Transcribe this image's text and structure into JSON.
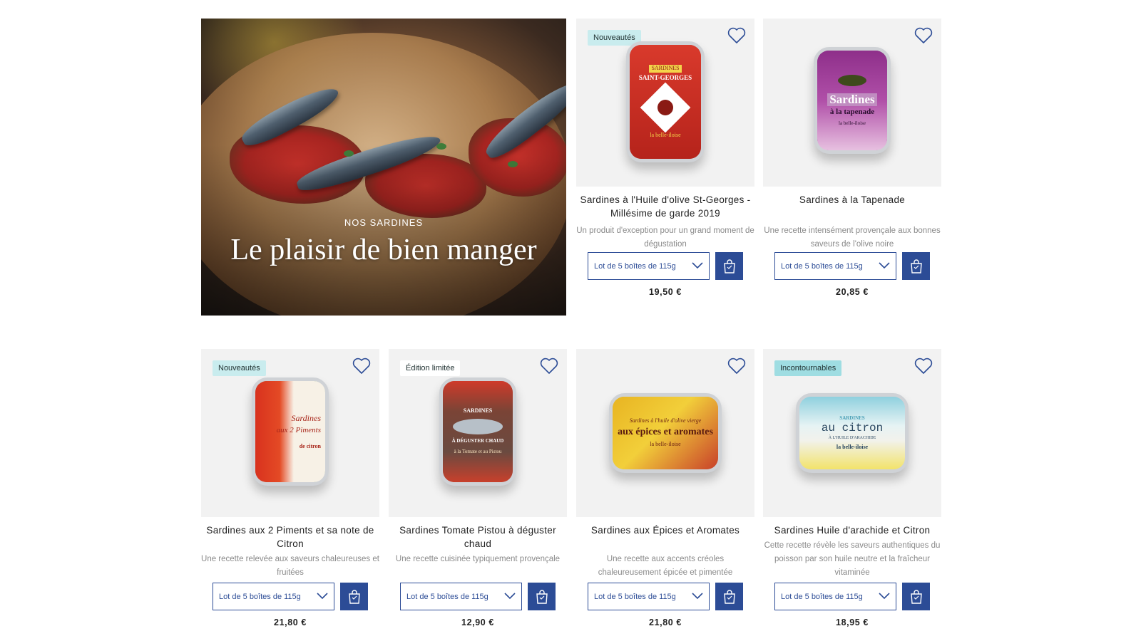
{
  "hero": {
    "kicker": "NOS SARDINES",
    "headline": "Le plaisir de bien manger"
  },
  "colors": {
    "accent": "#2c4c96",
    "badge_new": "#c9ecee",
    "badge_essential": "#9fdde2",
    "badge_limited": "#ffffff"
  },
  "products": [
    {
      "badge": "Nouveautés",
      "title": "Sardines à l'Huile d'olive St-Georges - Millésime de garde 2019",
      "description": "Un produit d'exception pour un grand moment de dégustation",
      "lot": "Lot de 5 boîtes de 115g",
      "price": "19,50 €",
      "can_text": [
        "SARDINES",
        "SAINT-GEORGES",
        "la belle-iloise"
      ]
    },
    {
      "badge": "",
      "title": "Sardines à la Tapenade",
      "description": "Une recette intensément provençale aux bonnes saveurs de l'olive noire",
      "lot": "Lot de 5 boîtes de 115g",
      "price": "20,85 €",
      "can_text": [
        "Sardines",
        "à la tapenade",
        "la belle-iloise"
      ]
    },
    {
      "badge": "Nouveautés",
      "title": "Sardines aux 2 Piments et sa note de Citron",
      "description": "Une recette relevée aux saveurs chaleureuses et fruitées",
      "lot": "Lot de 5 boîtes de 115g",
      "price": "21,80 €",
      "can_text": [
        "Sardines",
        "aux 2 Piments",
        "de citron"
      ]
    },
    {
      "badge": "Édition limitée",
      "title": "Sardines Tomate Pistou à déguster chaud",
      "description": "Une recette cuisinée typiquement provençale",
      "lot": "Lot de 5 boîtes de 115g",
      "price": "12,90 €",
      "can_text": [
        "SARDINES",
        "À DÉGUSTER CHAUD",
        "à la Tomate et au Pistou"
      ]
    },
    {
      "badge": "",
      "title": "Sardines aux Épices et Aromates",
      "description": "Une recette aux accents créoles chaleureusement épicée et pimentée",
      "lot": "Lot de 5 boîtes de 115g",
      "price": "21,80 €",
      "can_text": [
        "Sardines à l'huile d'olive vierge",
        "aux épices et aromates",
        "la belle-iloise"
      ]
    },
    {
      "badge": "Incontournables",
      "title": "Sardines Huile d'arachide et Citron",
      "description": "Cette recette révèle les saveurs authentiques du poisson par son huile neutre et la fraîcheur vitaminée",
      "lot": "Lot de 5 boîtes de 115g",
      "price": "18,95 €",
      "can_text": [
        "SARDINES",
        "au citron",
        "À L'HUILE D'ARACHIDE",
        "la belle-iloise"
      ]
    }
  ]
}
